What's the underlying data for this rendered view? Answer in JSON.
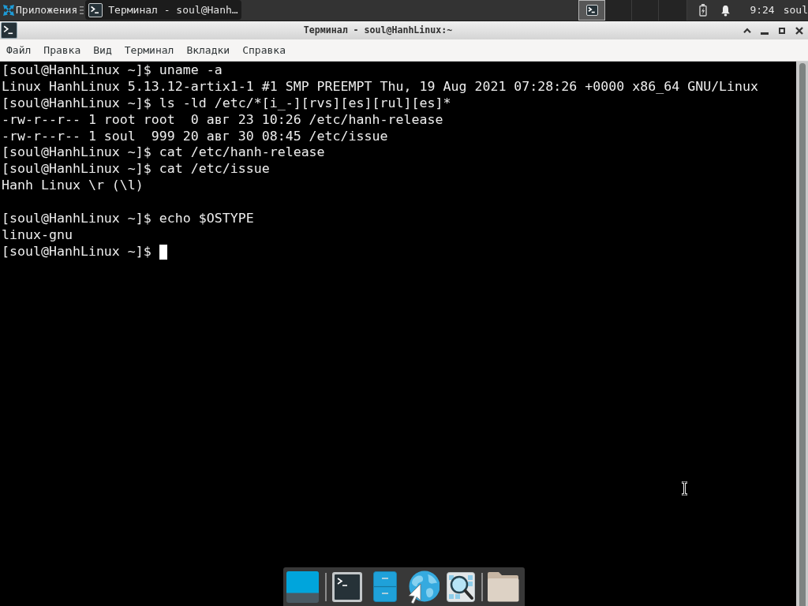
{
  "top_panel": {
    "apps_menu": "Приложения",
    "tasks": [
      {
        "title": "Терминал - soul@Hanh…",
        "selected": true
      }
    ],
    "workspaces": [
      {
        "selected": true,
        "occupied": true
      },
      {
        "selected": false,
        "occupied": false
      },
      {
        "selected": false,
        "occupied": false
      },
      {
        "selected": false,
        "occupied": false
      }
    ],
    "clock": "9:24",
    "user": "soul"
  },
  "window": {
    "title": "Терминал - soul@HanhLinux:~"
  },
  "menu": [
    "Файл",
    "Правка",
    "Вид",
    "Терминал",
    "Вкладки",
    "Справка"
  ],
  "terminal": {
    "lines": [
      {
        "kind": "command",
        "prompt": "[soul@HanhLinux ~]$",
        "command": "uname -a"
      },
      {
        "kind": "output",
        "text": "Linux HanhLinux 5.13.12-artix1-1 #1 SMP PREEMPT Thu, 19 Aug 2021 07:28:26 +0000 x86_64 GNU/Linux"
      },
      {
        "kind": "command",
        "prompt": "[soul@HanhLinux ~]$",
        "command": "ls -ld /etc/*[i_-][rvs][es][rul][es]*"
      },
      {
        "kind": "output",
        "text": "-rw-r--r-- 1 root root  0 авг 23 10:26 /etc/hanh-release"
      },
      {
        "kind": "output",
        "text": "-rw-r--r-- 1 soul  999 20 авг 30 08:45 /etc/issue"
      },
      {
        "kind": "command",
        "prompt": "[soul@HanhLinux ~]$",
        "command": "cat /etc/hanh-release"
      },
      {
        "kind": "command",
        "prompt": "[soul@HanhLinux ~]$",
        "command": "cat /etc/issue"
      },
      {
        "kind": "output",
        "text": "Hanh Linux \\r (\\l)"
      },
      {
        "kind": "blank"
      },
      {
        "kind": "command",
        "prompt": "[soul@HanhLinux ~]$",
        "command": "echo $OSTYPE"
      },
      {
        "kind": "output",
        "text": "linux-gnu"
      },
      {
        "kind": "input",
        "prompt": "[soul@HanhLinux ~]$"
      }
    ]
  },
  "dock": {
    "items": [
      {
        "kind": "desktop"
      },
      {
        "kind": "separator"
      },
      {
        "kind": "terminal"
      },
      {
        "kind": "files"
      },
      {
        "kind": "browser"
      },
      {
        "kind": "search"
      },
      {
        "kind": "separator"
      },
      {
        "kind": "folder"
      }
    ]
  }
}
